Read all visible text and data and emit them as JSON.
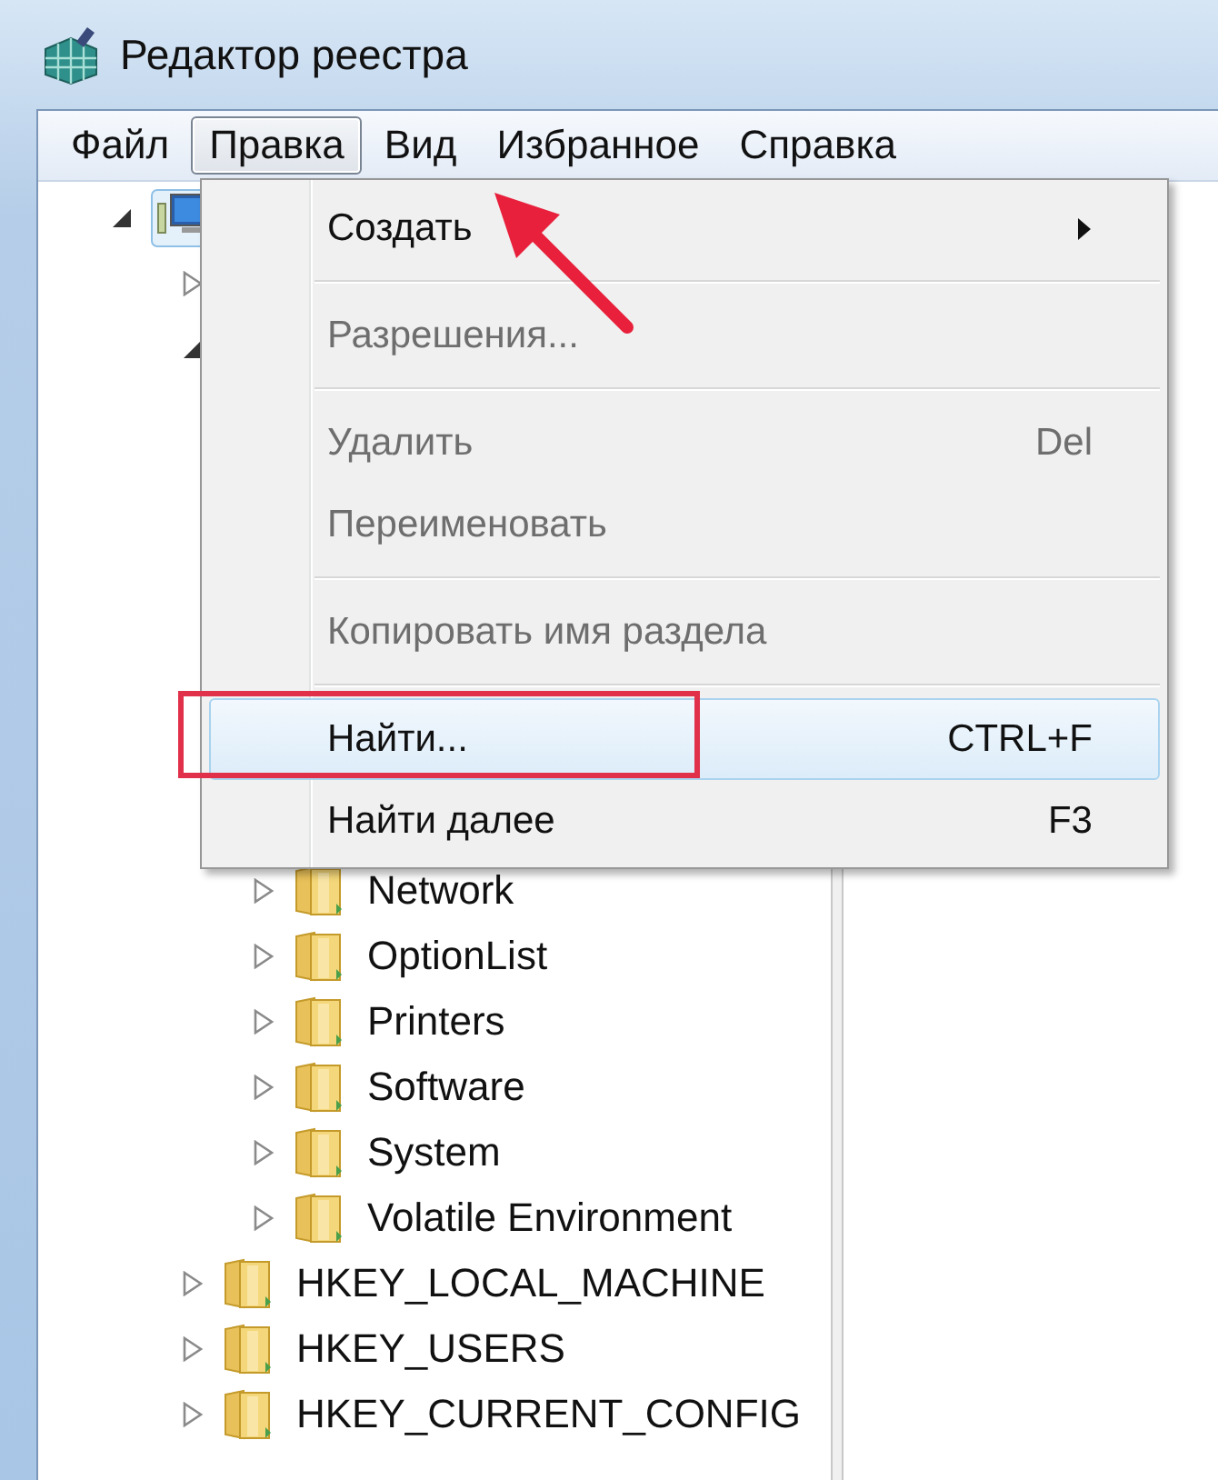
{
  "window": {
    "title": "Редактор реестра"
  },
  "menu_bar": [
    {
      "label": "Файл",
      "selected": false
    },
    {
      "label": "Правка",
      "selected": true
    },
    {
      "label": "Вид",
      "selected": false
    },
    {
      "label": "Избранное",
      "selected": false
    },
    {
      "label": "Справка",
      "selected": false
    }
  ],
  "edit_menu": {
    "items": [
      {
        "kind": "item",
        "label": "Создать",
        "disabled": false,
        "submenu": true,
        "selected": false
      },
      {
        "kind": "separator"
      },
      {
        "kind": "item",
        "label": "Разрешения...",
        "disabled": true,
        "selected": false
      },
      {
        "kind": "separator"
      },
      {
        "kind": "item",
        "label": "Удалить",
        "shortcut": "Del",
        "disabled": true,
        "selected": false
      },
      {
        "kind": "item",
        "label": "Переименовать",
        "disabled": true,
        "selected": false
      },
      {
        "kind": "separator"
      },
      {
        "kind": "item",
        "label": "Копировать имя раздела",
        "disabled": true,
        "selected": false
      },
      {
        "kind": "separator"
      },
      {
        "kind": "item",
        "label": "Найти...",
        "shortcut": "CTRL+F",
        "disabled": false,
        "selected": true
      },
      {
        "kind": "item",
        "label": "Найти далее",
        "shortcut": "F3",
        "disabled": false,
        "selected": false
      }
    ]
  },
  "tree": {
    "items": [
      {
        "kind": "computer",
        "expanded": true,
        "children": [
          {
            "kind": "folder",
            "expanded": false
          },
          {
            "kind": "folder",
            "expanded": true,
            "children": [
              {
                "kind": "folder",
                "label": "Network",
                "expanded": false
              },
              {
                "kind": "folder",
                "label": "OptionList",
                "expanded": false
              },
              {
                "kind": "folder",
                "label": "Printers",
                "expanded": false
              },
              {
                "kind": "folder",
                "label": "Software",
                "expanded": false
              },
              {
                "kind": "folder",
                "label": "System",
                "expanded": false
              },
              {
                "kind": "folder",
                "label": "Volatile Environment",
                "expanded": false
              }
            ]
          },
          {
            "kind": "folder",
            "label": "HKEY_LOCAL_MACHINE",
            "expanded": false
          },
          {
            "kind": "folder",
            "label": "HKEY_USERS",
            "expanded": false
          },
          {
            "kind": "folder",
            "label": "HKEY_CURRENT_CONFIG",
            "expanded": false
          }
        ]
      }
    ]
  }
}
